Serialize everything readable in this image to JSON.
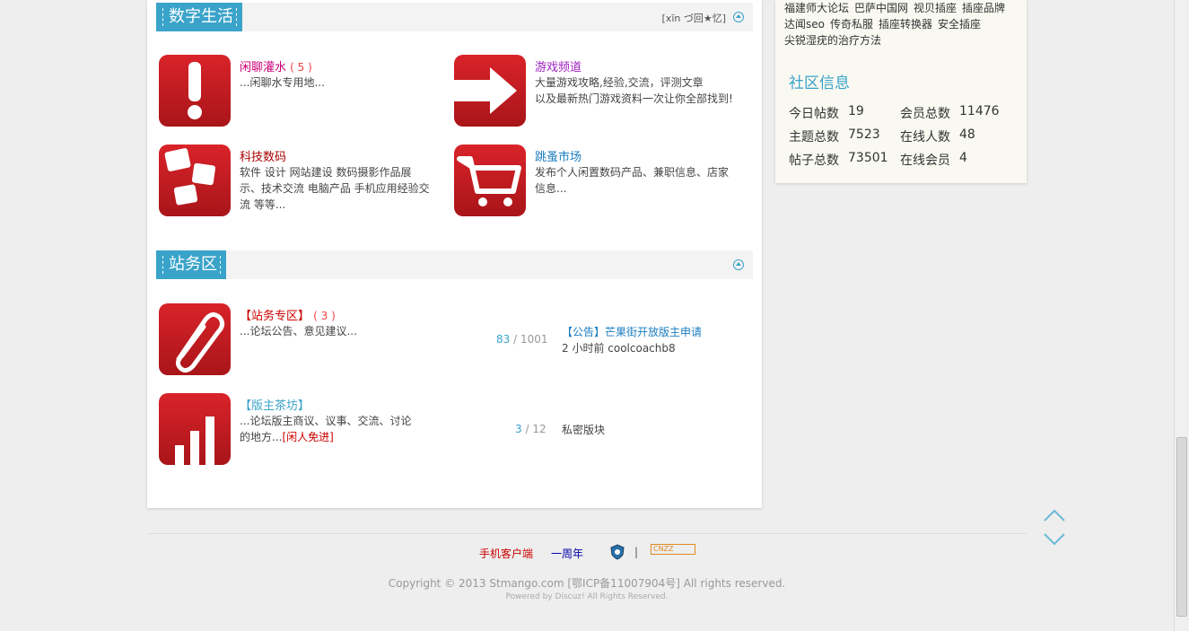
{
  "section1": {
    "title": "数字生活",
    "extra": "[xīn づ回★忆]",
    "forums": [
      {
        "name": "闲聊灌水",
        "count": "( 5 )",
        "desc": "...闲聊水专用地..."
      },
      {
        "name": "游戏频道",
        "desc1": "大量游戏攻略,经验,交流，评测文章",
        "desc2": "以及最新热门游戏资料一次让你全部找到!"
      },
      {
        "name": "科技数码",
        "desc1": "软件  设计   网站建设   数码摄影作品展",
        "desc2": "示、技术交流 电脑产品   手机应用经验交",
        "desc3": "流 等等..."
      },
      {
        "name": "跳蚤市场",
        "desc1": "发布个人闲置数码产品、兼职信息、店家",
        "desc2": "信息..."
      }
    ]
  },
  "section2": {
    "title": "站务区",
    "forums": [
      {
        "name": "【站务专区】",
        "count": "( 3 )",
        "desc": "...论坛公告、意见建议...",
        "threads": "83",
        "posts": "1001",
        "last_title": "【公告】芒果街开放版主申请",
        "last_info": "2 小时前 coolcoachb8"
      },
      {
        "name": "【版主茶坊】",
        "desc1": "...论坛版主商议、议事、交流、讨论",
        "desc2": "的地方...",
        "desc_highlight": "[闲人免进]",
        "threads": "3",
        "posts": "12",
        "last_title": "私密版块"
      }
    ]
  },
  "sidebar": {
    "links": [
      "福建师大论坛",
      "巴萨中国网",
      "视贝插座",
      "插座品牌",
      "达闻seo",
      "传奇私服",
      "插座转换器",
      "安全插座",
      "尖锐湿疣的治疗方法"
    ],
    "title": "社区信息",
    "stats": [
      {
        "label": "今日帖数",
        "value": "19",
        "label2": "会员总数",
        "value2": "11476"
      },
      {
        "label": "主题总数",
        "value": "7523",
        "label2": "在线人数",
        "value2": "48"
      },
      {
        "label": "帖子总数",
        "value": "73501",
        "label2": "在线会员",
        "value2": "4"
      }
    ]
  },
  "footer": {
    "mobile": "手机客户端",
    "anniversary": "一周年",
    "separator": "|",
    "cnzz": "CNZZ",
    "copyright": "Copyright © 2013 Stmango.com [鄂ICP备11007904号] All rights reserved.",
    "powered": "Powered by Discuz! All Rights Reserved."
  },
  "colors": {
    "accent": "#3aa3c9",
    "icon_red": "#c81c22",
    "pink_link": "#cc0077",
    "purple_link": "#a020c0",
    "dark_red": "#aa0000",
    "blue_link": "#1a7dc0"
  }
}
